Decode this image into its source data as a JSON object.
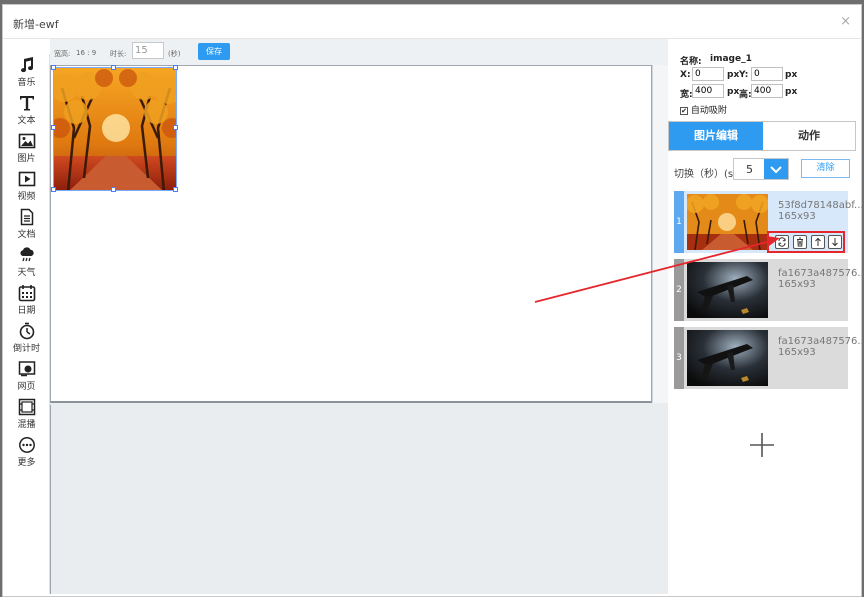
{
  "window": {
    "title": "新增-ewf",
    "close_glyph": "×"
  },
  "toolbar": {
    "items": [
      {
        "label": "音乐",
        "icon": "music-icon"
      },
      {
        "label": "文本",
        "icon": "text-icon"
      },
      {
        "label": "图片",
        "icon": "image-icon"
      },
      {
        "label": "视频",
        "icon": "video-icon"
      },
      {
        "label": "文档",
        "icon": "document-icon"
      },
      {
        "label": "天气",
        "icon": "weather-icon"
      },
      {
        "label": "日期",
        "icon": "calendar-icon"
      },
      {
        "label": "倒计时",
        "icon": "countdown-icon"
      },
      {
        "label": "网页",
        "icon": "webpage-icon"
      },
      {
        "label": "混播",
        "icon": "mix-play-icon"
      },
      {
        "label": "更多",
        "icon": "more-icon"
      }
    ]
  },
  "canvas": {
    "ratio_label": "宽高:",
    "ratio_value": "16 : 9",
    "duration_label": "时长:",
    "duration_value": "15",
    "duration_unit": "(秒)",
    "save_label": "保存"
  },
  "properties": {
    "name_label": "名称:",
    "name_value": "image_1",
    "x_label": "X:",
    "x_value": "0",
    "y_label": "Y:",
    "y_value": "0",
    "w_label": "宽:",
    "w_value": "400",
    "h_label": "高:",
    "h_value": "400",
    "unit": "px",
    "auto_snap_label": "自动吸附",
    "auto_snap_checked": true
  },
  "tabs": {
    "image_edit": "图片编辑",
    "action": "动作"
  },
  "switch": {
    "label": "切换（秒）(s)",
    "value": "5",
    "clear_label": "清除"
  },
  "image_list": [
    {
      "index": "1",
      "filename": "53f8d78148abf...",
      "size": "165x93",
      "selected": true
    },
    {
      "index": "2",
      "filename": "fa1673a487576...",
      "size": "165x93",
      "selected": false
    },
    {
      "index": "3",
      "filename": "fa1673a487576...",
      "size": "165x93",
      "selected": false
    }
  ],
  "colors": {
    "accent": "#2e9bf0",
    "highlight_box": "#e5262d",
    "annotation_arrow": "#e5262d"
  }
}
